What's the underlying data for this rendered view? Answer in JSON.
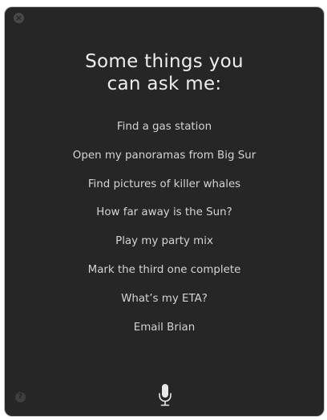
{
  "window": {
    "close_icon": "close-x-icon",
    "help_icon": "question-icon",
    "help_glyph": "?",
    "mic_icon": "microphone-icon"
  },
  "title": {
    "line1": "Some things you",
    "line2": "can ask me:"
  },
  "suggestions": [
    "Find a gas station",
    "Open my panoramas from Big Sur",
    "Find pictures of killer whales",
    "How far away is the Sun?",
    "Play my party mix",
    "Mark the third one complete",
    "What’s my ETA?",
    "Email Brian"
  ],
  "colors": {
    "panel_background": "#262626",
    "text": "#d4d4d4",
    "title_text": "#eeeeee"
  }
}
